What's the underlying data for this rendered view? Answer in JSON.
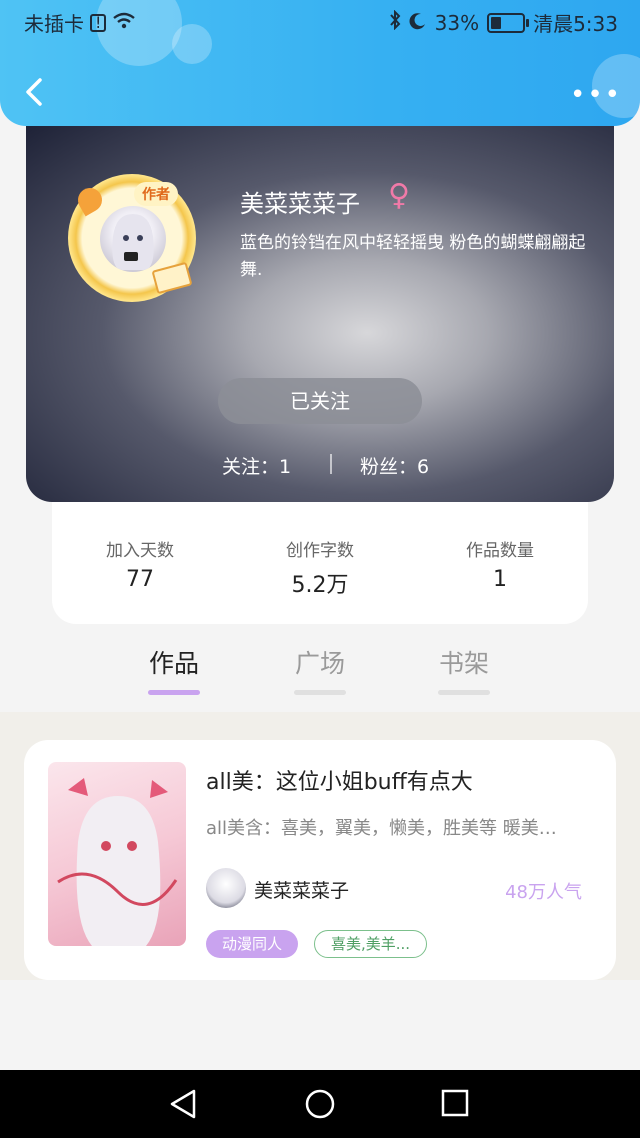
{
  "status_bar": {
    "carrier": "未插卡",
    "battery": "33%",
    "battery_level": 0.33,
    "time": "清晨5:33"
  },
  "profile": {
    "author_tag": "作者",
    "name": "美菜菜菜子",
    "gender_symbol": "♀",
    "bio": "蓝色的铃铛在风中轻轻摇曳 粉色的蝴蝶翩翩起舞.",
    "follow_button": "已关注",
    "following": "关注：1",
    "fans": "粉丝：6"
  },
  "stats": [
    {
      "label": "加入天数",
      "value": "77"
    },
    {
      "label": "创作字数",
      "value": "5.2万"
    },
    {
      "label": "作品数量",
      "value": "1"
    }
  ],
  "tabs": [
    {
      "label": "作品",
      "active": true
    },
    {
      "label": "广场",
      "active": false
    },
    {
      "label": "书架",
      "active": false
    }
  ],
  "works": [
    {
      "title": "all美：这位小姐buff有点大",
      "description": "all美含：喜美，翼美，懒美，胜美等 暖美…",
      "author": "美菜菜菜子",
      "popularity": "48万人气",
      "tags": [
        "动漫同人",
        "喜美,美羊..."
      ]
    }
  ],
  "colors": {
    "header": "#36b0f2",
    "accent": "#c9a3ef",
    "tag_green": "#4f9f64"
  }
}
